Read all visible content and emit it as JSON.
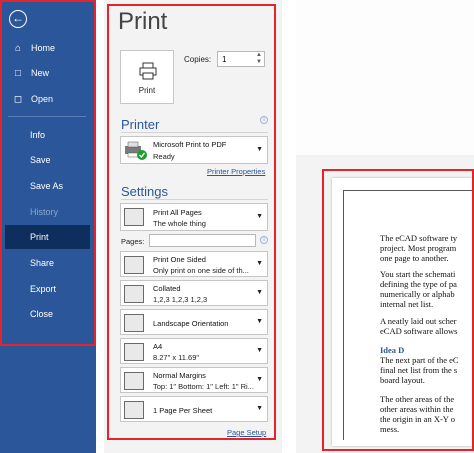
{
  "nav": {
    "items": [
      {
        "label": "Home",
        "icon": "home-icon"
      },
      {
        "label": "New",
        "icon": "new-document-icon"
      },
      {
        "label": "Open",
        "icon": "folder-icon"
      },
      {
        "label": "Info"
      },
      {
        "label": "Save"
      },
      {
        "label": "Save As"
      },
      {
        "label": "History"
      },
      {
        "label": "Print"
      },
      {
        "label": "Share"
      },
      {
        "label": "Export"
      },
      {
        "label": "Close"
      }
    ],
    "selected": "Print",
    "disabled": "History"
  },
  "print": {
    "title": "Print",
    "button_label": "Print",
    "copies_label": "Copies:",
    "copies_value": "1"
  },
  "printer": {
    "heading": "Printer",
    "name": "Microsoft Print to PDF",
    "status": "Ready",
    "properties_link": "Printer Properties"
  },
  "settings": {
    "heading": "Settings",
    "pages_label": "Pages:",
    "pages_value": "",
    "options": [
      {
        "line1": "Print All Pages",
        "line2": "The whole thing"
      },
      {
        "line1": "Print One Sided",
        "line2": "Only print on one side of th..."
      },
      {
        "line1": "Collated",
        "line2": "1,2,3    1,2,3    1,2,3"
      },
      {
        "line1": "Landscape Orientation",
        "line2": ""
      },
      {
        "line1": "A4",
        "line2": "8.27\" x 11.69\""
      },
      {
        "line1": "Normal Margins",
        "line2": "Top: 1\" Bottom: 1\" Left: 1\" Ri..."
      },
      {
        "line1": "1 Page Per Sheet",
        "line2": ""
      }
    ],
    "page_setup_link": "Page Setup"
  },
  "preview": {
    "lines": [
      {
        "text": "The eCAD software ty",
        "style": "normal"
      },
      {
        "text": "project. Most program",
        "style": "normal"
      },
      {
        "text": "one page to another.",
        "style": "normal"
      },
      {
        "text": "You start the schemati",
        "style": "normal"
      },
      {
        "text": "defining the type of pa",
        "style": "normal"
      },
      {
        "text": "numerically or alphab",
        "style": "normal"
      },
      {
        "text": "internal net list.",
        "style": "normal"
      },
      {
        "text": "A neatly laid out scher",
        "style": "normal"
      },
      {
        "text": "eCAD software allows",
        "style": "normal"
      },
      {
        "text": "Idea D",
        "style": "heading"
      },
      {
        "text": "The next part of the eC",
        "style": "normal"
      },
      {
        "text": "final net list from the s",
        "style": "normal"
      },
      {
        "text": "board layout.",
        "style": "normal"
      },
      {
        "text": "The other areas of the",
        "style": "normal"
      },
      {
        "text": "other areas within the",
        "style": "normal"
      },
      {
        "text": "the origin in an X-Y o",
        "style": "normal"
      },
      {
        "text": "mess.",
        "style": "normal"
      }
    ]
  },
  "colors": {
    "accent": "#2b579a",
    "highlight_frame": "#e3242b",
    "nav_selected": "#0e2e5e"
  }
}
